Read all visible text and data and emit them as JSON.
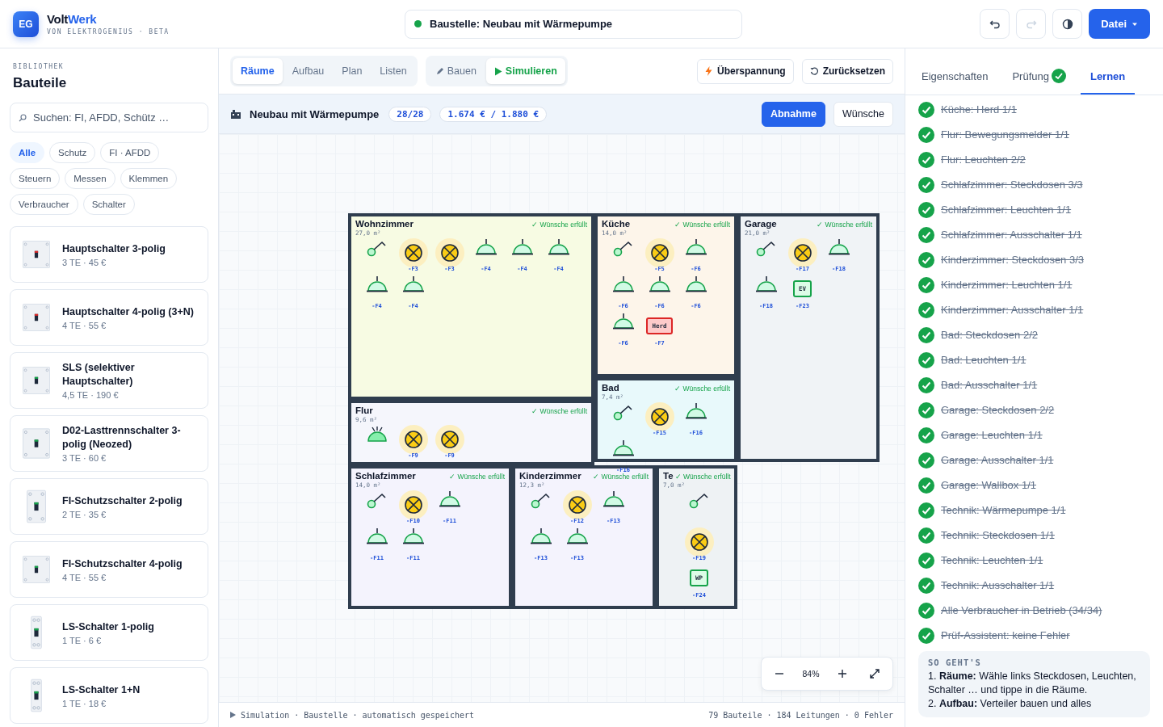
{
  "header": {
    "logo": "EG",
    "brand_first": "Volt",
    "brand_second": "Werk",
    "subtitle": "VON ELEKTROGENIUS · BETA",
    "site": {
      "text": "Baustelle: Neubau mit Wärmepumpe",
      "online": true
    },
    "redo_disabled": true,
    "file_button": "Datei"
  },
  "library": {
    "eyebrow": "BIBLIOTHEK",
    "title": "Bauteile",
    "search": {
      "placeholder": "Suchen: FI, AFDD, Schütz …"
    },
    "filters": [
      {
        "label": "Alle",
        "selected": true
      },
      {
        "label": "Schutz",
        "selected": false
      },
      {
        "label": "FI · AFDD",
        "selected": false
      },
      {
        "label": "Steuern",
        "selected": false
      },
      {
        "label": "Messen",
        "selected": false
      },
      {
        "label": "Klemmen",
        "selected": false
      },
      {
        "label": "Verbraucher",
        "selected": false
      },
      {
        "label": "Schalter",
        "selected": false
      }
    ],
    "items": [
      {
        "name": "Hauptschalter 3-polig",
        "meta": "3 TE · 45 €"
      },
      {
        "name": "Hauptschalter 4-polig (3+N)",
        "meta": "4 TE · 55 €"
      },
      {
        "name": "SLS (selektiver Hauptschalter)",
        "meta": "4,5 TE · 190 €"
      },
      {
        "name": "D02-Lasttrennschalter 3-polig (Neozed)",
        "meta": "3 TE · 60 €"
      },
      {
        "name": "FI-Schutzschalter 2-polig",
        "meta": "2 TE · 35 €"
      },
      {
        "name": "FI-Schutzschalter 4-polig",
        "meta": "4 TE · 55 €"
      },
      {
        "name": "LS-Schalter 1-polig",
        "meta": "1 TE · 6 €"
      },
      {
        "name": "LS-Schalter 1+N",
        "meta": "1 TE · 18 €"
      }
    ]
  },
  "toolbar": {
    "tabs": [
      {
        "label": "Räume",
        "selected": true
      },
      {
        "label": "Aufbau",
        "selected": false
      },
      {
        "label": "Plan",
        "selected": false
      },
      {
        "label": "Listen",
        "selected": false
      }
    ],
    "modes": [
      {
        "label": "Bauen",
        "selected": false
      },
      {
        "label": "Simulieren",
        "selected": true
      }
    ],
    "actions": [
      "Überspannung",
      "Zurücksetzen"
    ]
  },
  "project": {
    "title": "Neubau mit Wärmepumpe",
    "count": "28/28",
    "budget": "1.674 € / 1.880 €",
    "buttons": [
      {
        "label": "Abnahme",
        "primary": true
      },
      {
        "label": "Wünsche",
        "primary": false
      }
    ]
  },
  "rooms": [
    {
      "name": "Wohnzimmer",
      "area": "27,0 m²",
      "status": "✓ Wünsche erfüllt",
      "color": "#f7fbe3",
      "devices": [
        {
          "kind": "switch"
        },
        {
          "kind": "socket",
          "label": "-F3"
        },
        {
          "kind": "socket",
          "label": "-F3"
        },
        {
          "kind": "lamp",
          "label": "-F4"
        },
        {
          "kind": "lamp",
          "label": "-F4"
        },
        {
          "kind": "lamp",
          "label": "-F4"
        },
        {
          "kind": "lamp",
          "label": "-F4"
        },
        {
          "kind": "lamp",
          "label": "-F4"
        }
      ]
    },
    {
      "name": "Küche",
      "area": "14,0 m²",
      "status": "✓ Wünsche erfüllt",
      "color": "#fdf5ea",
      "devices": [
        {
          "kind": "switch"
        },
        {
          "kind": "socket",
          "label": "-F5"
        },
        {
          "kind": "lamp",
          "label": "-F6"
        },
        {
          "kind": "lamp",
          "label": "-F6"
        },
        {
          "kind": "lamp",
          "label": "-F6"
        },
        {
          "kind": "lamp",
          "label": "-F6"
        },
        {
          "kind": "lamp",
          "label": "-F6"
        },
        {
          "kind": "appliance",
          "text": "Herd",
          "fault": true,
          "label": "-F7"
        }
      ]
    },
    {
      "name": "Garage",
      "area": "21,0 m²",
      "status": "✓ Wünsche erfüllt",
      "color": "#f0f3f6",
      "devices": [
        {
          "kind": "switch"
        },
        {
          "kind": "socket",
          "label": "-F17"
        },
        {
          "kind": "lamp",
          "label": "-F18"
        },
        {
          "kind": "lamp",
          "label": "-F18"
        },
        {
          "kind": "appliance",
          "text": "EV",
          "fault": false,
          "label": "-F23"
        }
      ]
    },
    {
      "name": "Bad",
      "area": "7,4 m²",
      "status": "✓ Wünsche erfüllt",
      "color": "#e8f9fb",
      "devices": [
        {
          "kind": "switch"
        },
        {
          "kind": "socket",
          "label": "-F15"
        },
        {
          "kind": "lamp",
          "label": "-F16"
        },
        {
          "kind": "lamp",
          "label": "-F16"
        }
      ]
    },
    {
      "name": "Flur",
      "area": "9,6 m²",
      "status": "✓ Wünsche erfüllt",
      "color": "#f5f6fc",
      "devices": [
        {
          "kind": "motion"
        },
        {
          "kind": "socket",
          "label": "-F9"
        },
        {
          "kind": "socket",
          "label": "-F9"
        }
      ]
    },
    {
      "name": "Schlafzimmer",
      "area": "14,0 m²",
      "status": "✓ Wünsche erfüllt",
      "color": "#f4f3fd",
      "devices": [
        {
          "kind": "switch"
        },
        {
          "kind": "socket",
          "label": "-F10"
        },
        {
          "kind": "lamp",
          "label": "-F11"
        },
        {
          "kind": "lamp",
          "label": "-F11"
        },
        {
          "kind": "lamp",
          "label": "-F11"
        }
      ]
    },
    {
      "name": "Kinderzimmer",
      "area": "12,3 m²",
      "status": "✓ Wünsche erfüllt",
      "color": "#f4f3fd",
      "devices": [
        {
          "kind": "switch"
        },
        {
          "kind": "socket",
          "label": "-F12"
        },
        {
          "kind": "lamp",
          "label": "-F13"
        },
        {
          "kind": "lamp",
          "label": "-F13"
        },
        {
          "kind": "lamp",
          "label": "-F13"
        }
      ]
    },
    {
      "name": "Te",
      "area": "7,0 m²",
      "status": "✓ Wünsche erfüllt",
      "color": "#eef2f4",
      "devices": [
        {
          "kind": "switch"
        },
        {
          "kind": "socket",
          "label": "-F19"
        },
        {
          "kind": "appliance",
          "text": "WP",
          "fault": false,
          "label": "-F24"
        }
      ]
    }
  ],
  "zoom": {
    "value": "84%"
  },
  "status_bar": {
    "left": "Simulation · Baustelle · automatisch gespeichert",
    "right": "79 Bauteile · 184 Leitungen · 0 Fehler"
  },
  "panel": {
    "tabs": [
      {
        "label": "Eigenschaften",
        "selected": false,
        "ok": false
      },
      {
        "label": "Prüfung",
        "selected": false,
        "ok": true
      },
      {
        "label": "Lernen",
        "selected": true,
        "ok": false
      }
    ],
    "checklist": [
      {
        "text": "Küche: Herd 1/1",
        "done": true
      },
      {
        "text": "Flur: Bewegungsmelder 1/1",
        "done": true
      },
      {
        "text": "Flur: Leuchten 2/2",
        "done": true
      },
      {
        "text": "Schlafzimmer: Steckdosen 3/3",
        "done": true
      },
      {
        "text": "Schlafzimmer: Leuchten 1/1",
        "done": true
      },
      {
        "text": "Schlafzimmer: Ausschalter 1/1",
        "done": true
      },
      {
        "text": "Kinderzimmer: Steckdosen 3/3",
        "done": true
      },
      {
        "text": "Kinderzimmer: Leuchten 1/1",
        "done": true
      },
      {
        "text": "Kinderzimmer: Ausschalter 1/1",
        "done": true
      },
      {
        "text": "Bad: Steckdosen 2/2",
        "done": true
      },
      {
        "text": "Bad: Leuchten 1/1",
        "done": true
      },
      {
        "text": "Bad: Ausschalter 1/1",
        "done": true
      },
      {
        "text": "Garage: Steckdosen 2/2",
        "done": true
      },
      {
        "text": "Garage: Leuchten 1/1",
        "done": true
      },
      {
        "text": "Garage: Ausschalter 1/1",
        "done": true
      },
      {
        "text": "Garage: Wallbox 1/1",
        "done": true
      },
      {
        "text": "Technik: Wärmepumpe 1/1",
        "done": true
      },
      {
        "text": "Technik: Steckdosen 1/1",
        "done": true
      },
      {
        "text": "Technik: Leuchten 1/1",
        "done": true
      },
      {
        "text": "Technik: Ausschalter 1/1",
        "done": true
      },
      {
        "text": "Alle Verbraucher in Betrieb (34/34)",
        "done": true
      },
      {
        "text": "Prüf-Assistent: keine Fehler",
        "done": true
      }
    ],
    "help": {
      "title": "SO GEHT'S",
      "steps": [
        "1. **Räume:** Wähle links Steckdosen, Leuchten, Schalter … und tippe in die Räume.",
        "2. **Aufbau:** Verteiler bauen und alles"
      ]
    }
  }
}
